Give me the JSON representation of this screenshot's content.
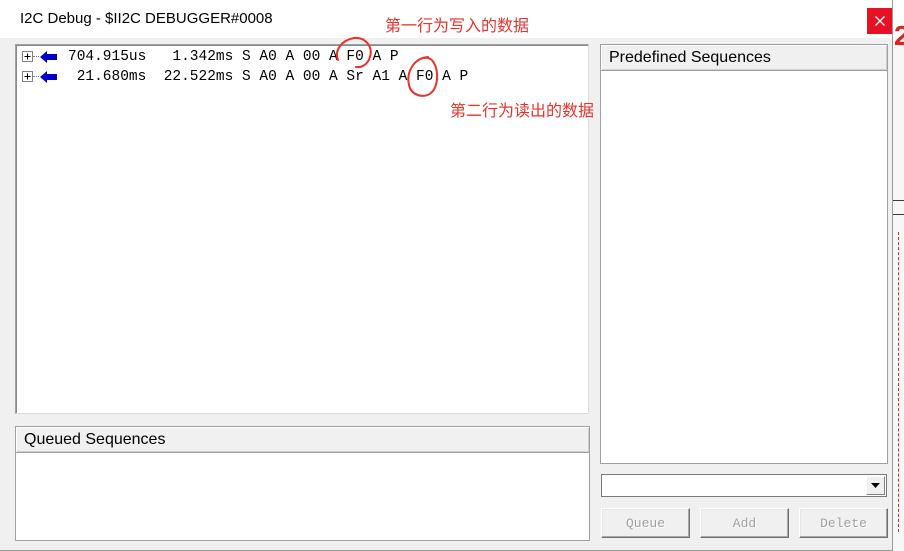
{
  "window": {
    "title": "I2C Debug - $II2C DEBUGGER#0008",
    "close_icon": "close-icon"
  },
  "trace": {
    "rows": [
      {
        "expander_icon": "plus-box-icon",
        "direction_icon": "left-arrow-icon",
        "start": "704.915us",
        "end": "1.342ms",
        "sequence": "S A0 A 00 A F0 A P"
      },
      {
        "expander_icon": "plus-box-icon",
        "direction_icon": "left-arrow-icon",
        "start": "21.680ms",
        "end": "22.522ms",
        "sequence": "S A0 A 00 A Sr A1 A F0 A P"
      }
    ]
  },
  "annotations": {
    "write_note": "第一行为写入的数据",
    "read_note": "第二行为读出的数据"
  },
  "queued_sequences": {
    "title": "Queued Sequences"
  },
  "predefined_sequences": {
    "title": "Predefined Sequences",
    "selected": "",
    "dropdown_icon": "chevron-down-icon"
  },
  "buttons": {
    "queue": "Queue",
    "add": "Add",
    "delete": "Delete"
  },
  "background": {
    "schematic_fragment": "2"
  },
  "colors": {
    "direction_arrow": "#0000c8",
    "close_button": "#e81123",
    "annotation": "#e8322b",
    "disabled_text": "#a0a0a0"
  }
}
